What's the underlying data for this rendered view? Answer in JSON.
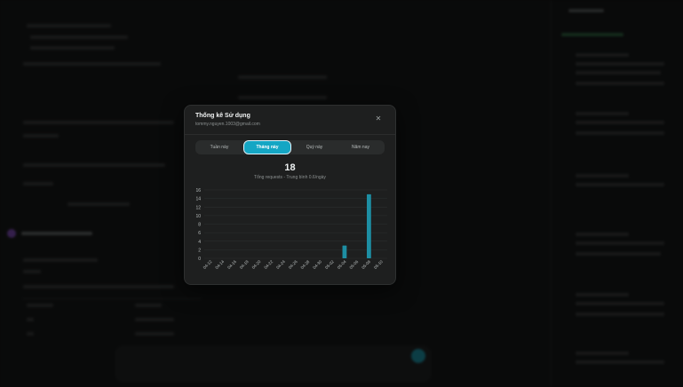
{
  "modal": {
    "title": "Thống kê Sử dụng",
    "email": "tommy.nguyen.1003@gmail.com",
    "close_icon": "close-icon",
    "tabs": [
      {
        "label": "Tuần này",
        "active": false
      },
      {
        "label": "Tháng này",
        "active": true
      },
      {
        "label": "Quý này",
        "active": false
      },
      {
        "label": "Năm nay",
        "active": false
      }
    ],
    "total_requests": "18",
    "caption": "Tổng requests - Trung bình 0.6/ngày"
  },
  "colors": {
    "accent": "#14a6c4",
    "bar": "#1d8ea3",
    "modal_bg": "#1e1f1f"
  },
  "chart_data": {
    "type": "bar",
    "categories": [
      "04-12",
      "04-14",
      "04-16",
      "04-18",
      "04-20",
      "04-22",
      "04-24",
      "04-26",
      "04-28",
      "04-30",
      "05-02",
      "05-04",
      "05-06",
      "05-08",
      "05-10"
    ],
    "values": [
      0,
      0,
      0,
      0,
      0,
      0,
      0,
      0,
      0,
      0,
      0,
      3,
      0,
      15,
      0
    ],
    "ylim": [
      0,
      16
    ],
    "yticks": [
      0,
      2,
      4,
      6,
      8,
      10,
      12,
      14,
      16
    ],
    "grid": true
  }
}
